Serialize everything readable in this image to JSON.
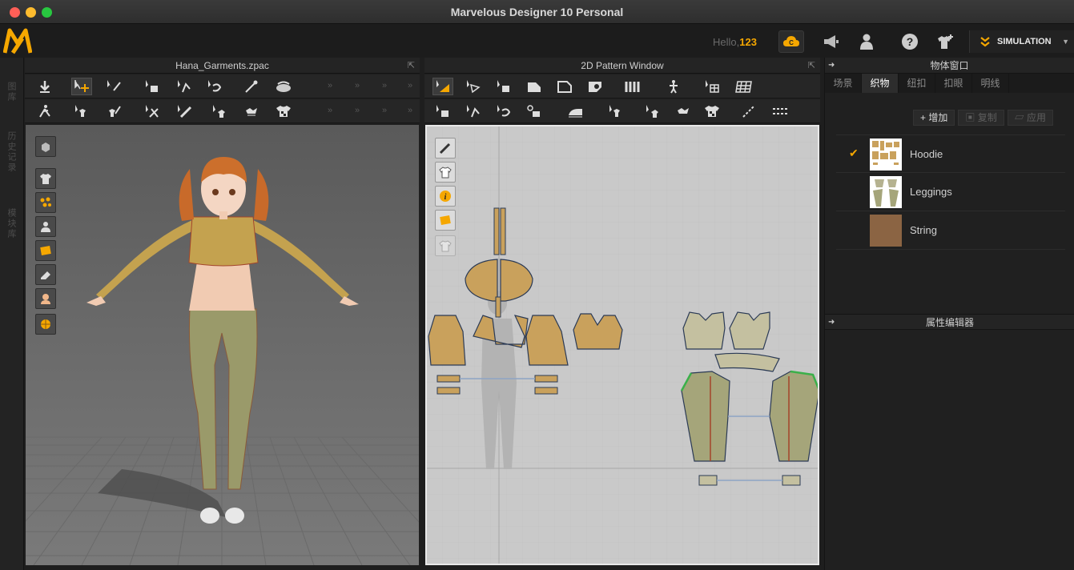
{
  "window": {
    "title": "Marvelous Designer 10 Personal"
  },
  "topbar": {
    "hello_prefix": "Hello,",
    "user_number": "123",
    "simulation_label": "SIMULATION"
  },
  "left_strip": {
    "items": [
      "图库",
      "历史记录",
      "模块库"
    ]
  },
  "panel3d": {
    "title": "Hana_Garments.zpac"
  },
  "panel2d": {
    "title": "2D Pattern Window"
  },
  "right_panel": {
    "title": "物体窗口",
    "tabs": [
      "场景",
      "织物",
      "纽扣",
      "扣眼",
      "明线"
    ],
    "active_tab": "织物",
    "actions": {
      "add": "+ 增加",
      "copy": "复制",
      "apply": "应用"
    },
    "fabrics": [
      {
        "name": "Hoodie",
        "selected": true,
        "thumb": "pattern-thumb"
      },
      {
        "name": "Leggings",
        "selected": false,
        "thumb": "pattern-thumb"
      },
      {
        "name": "String",
        "selected": false,
        "thumb": "color-swatch",
        "color": "#8b6443"
      }
    ],
    "property_editor_title": "属性编辑器"
  },
  "colors": {
    "accent": "#f5a700",
    "fabric_tan": "#c9a15c",
    "legging_green": "#9a9a6a"
  }
}
